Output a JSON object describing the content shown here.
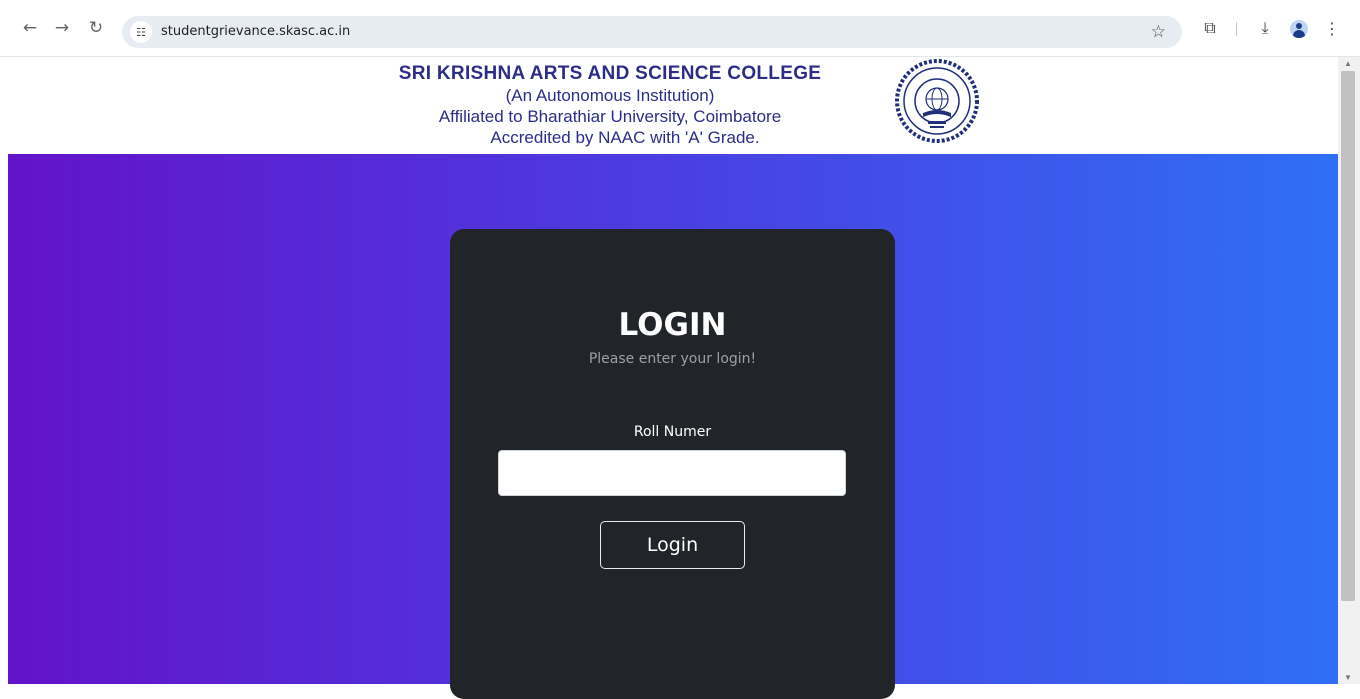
{
  "browser": {
    "url": "studentgrievance.skasc.ac.in",
    "icons": {
      "back": "arrow-left-icon",
      "forward": "arrow-right-icon",
      "reload": "reload-icon",
      "site_info": "tune-icon",
      "bookmark": "star-icon",
      "extensions": "puzzle-icon",
      "downloads": "download-icon",
      "profile": "person-icon",
      "menu": "more-vertical-icon"
    }
  },
  "header": {
    "college_name": "SRI KRISHNA  ARTS AND SCIENCE COLLEGE",
    "autonomous": "(An Autonomous Institution)",
    "affiliation": "Affiliated to Bharathiar University, Coimbatore",
    "accreditation": "Accredited by NAAC with 'A' Grade."
  },
  "login": {
    "title": "LOGIN",
    "subtitle": "Please enter your login!",
    "roll_label": "Roll Numer",
    "roll_value": "",
    "button_label": "Login"
  },
  "colors": {
    "gradient_start": "#6313c9",
    "gradient_end": "#2f6ff5",
    "card_bg": "#212529",
    "college_text": "#2b2d88"
  }
}
